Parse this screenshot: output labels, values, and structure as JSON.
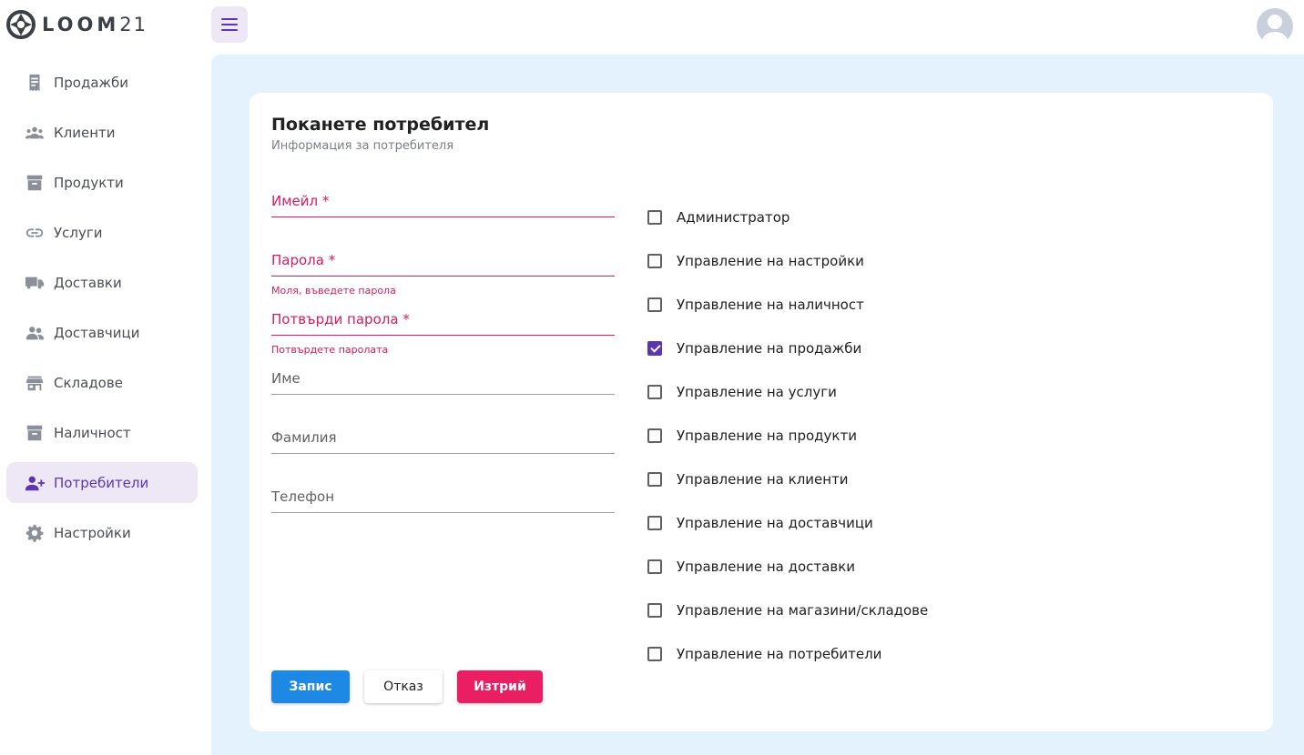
{
  "brand": {
    "name": "LOOM",
    "suffix": "21"
  },
  "sidebar": {
    "items": [
      {
        "label": "Продажби",
        "icon": "receipt-icon"
      },
      {
        "label": "Клиенти",
        "icon": "group-icon"
      },
      {
        "label": "Продукти",
        "icon": "archive-box-icon"
      },
      {
        "label": "Услуги",
        "icon": "link-icon"
      },
      {
        "label": "Доставки",
        "icon": "truck-icon"
      },
      {
        "label": "Доставчици",
        "icon": "people-icon"
      },
      {
        "label": "Складове",
        "icon": "store-icon"
      },
      {
        "label": "Наличност",
        "icon": "archive-box-icon"
      },
      {
        "label": "Потребители",
        "icon": "person-add-icon",
        "active": true
      },
      {
        "label": "Настройки",
        "icon": "gear-icon"
      }
    ]
  },
  "header": {
    "menu_icon": "hamburger-icon",
    "avatar_icon": "user-avatar-icon"
  },
  "form": {
    "title": "Поканете потребител",
    "subtitle": "Информация за потребителя",
    "fields": {
      "email": {
        "label": "Имейл *"
      },
      "password": {
        "label": "Парола *",
        "error": "Моля, въведете парола"
      },
      "confirm": {
        "label": "Потвърди парола *",
        "error": "Потвърдете паролата"
      },
      "first_name": {
        "label": "Име"
      },
      "last_name": {
        "label": "Фамилия"
      },
      "phone": {
        "label": "Телефон"
      }
    },
    "permissions": [
      {
        "label": "Администратор",
        "checked": false
      },
      {
        "label": "Управление на настройки",
        "checked": false
      },
      {
        "label": "Управление на наличност",
        "checked": false
      },
      {
        "label": "Управление на продажби",
        "checked": true
      },
      {
        "label": "Управление на услуги",
        "checked": false
      },
      {
        "label": "Управление на продукти",
        "checked": false
      },
      {
        "label": "Управление на клиенти",
        "checked": false
      },
      {
        "label": "Управление на доставчици",
        "checked": false
      },
      {
        "label": "Управление на доставки",
        "checked": false
      },
      {
        "label": "Управление на магазини/складове",
        "checked": false
      },
      {
        "label": "Управление на потребители",
        "checked": false
      }
    ],
    "buttons": {
      "save": "Запис",
      "cancel": "Отказ",
      "delete": "Изтрий"
    }
  },
  "colors": {
    "accent": "#5e35b1",
    "error": "#d81b60",
    "primary": "#1e88e5",
    "danger": "#e91e63",
    "main_bg": "#e3f2fd"
  }
}
